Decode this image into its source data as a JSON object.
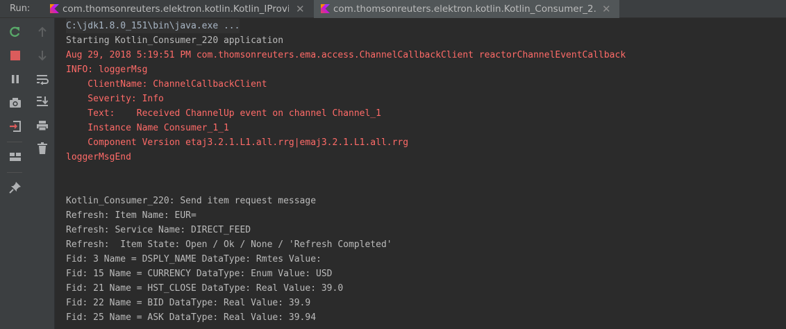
{
  "run_panel": {
    "label": "Run:",
    "tabs": [
      {
        "label": "com.thomsonreuters.elektron.kotlin.Kotlin_IProvi...",
        "active": false,
        "icon": "kotlin-icon"
      },
      {
        "label": "com.thomsonreuters.elektron.kotlin.Kotlin_Consumer_2...",
        "active": true,
        "icon": "kotlin-icon"
      }
    ]
  },
  "toolbar": {
    "left": [
      "rerun-icon",
      "stop-icon",
      "pause-icon",
      "dump-threads-icon",
      "exit-icon",
      "layout-icon",
      "pin-icon"
    ],
    "right": [
      "scroll-up-icon",
      "scroll-down-icon",
      "soft-wrap-icon",
      "scroll-to-end-icon",
      "print-icon",
      "clear-icon"
    ]
  },
  "colors": {
    "stdout": "#bbbbbb",
    "stderr": "#ff6b68",
    "rerun_green": "#59a869",
    "stop_red": "#db5c5c"
  },
  "console": {
    "lines": [
      {
        "text": "C:\\jdk1.8.0_151\\bin\\java.exe ...",
        "kind": "cmd"
      },
      {
        "text": "Starting Kotlin_Consumer_220 application",
        "kind": "out"
      },
      {
        "text": "Aug 29, 2018 5:19:51 PM com.thomsonreuters.ema.access.ChannelCallbackClient reactorChannelEventCallback",
        "kind": "err"
      },
      {
        "text": "INFO: loggerMsg",
        "kind": "err"
      },
      {
        "text": "    ClientName: ChannelCallbackClient",
        "kind": "err"
      },
      {
        "text": "    Severity: Info",
        "kind": "err"
      },
      {
        "text": "    Text:    Received ChannelUp event on channel Channel_1",
        "kind": "err"
      },
      {
        "text": "    Instance Name Consumer_1_1",
        "kind": "err"
      },
      {
        "text": "    Component Version etaj3.2.1.L1.all.rrg|emaj3.2.1.L1.all.rrg",
        "kind": "err"
      },
      {
        "text": "loggerMsgEnd",
        "kind": "err"
      },
      {
        "text": "",
        "kind": "out"
      },
      {
        "text": "",
        "kind": "out"
      },
      {
        "text": "Kotlin_Consumer_220: Send item request message",
        "kind": "out"
      },
      {
        "text": "Refresh: Item Name: EUR=",
        "kind": "out"
      },
      {
        "text": "Refresh: Service Name: DIRECT_FEED",
        "kind": "out"
      },
      {
        "text": "Refresh:  Item State: Open / Ok / None / 'Refresh Completed'",
        "kind": "out"
      },
      {
        "text": "Fid: 3 Name = DSPLY_NAME DataType: Rmtes Value:",
        "kind": "out"
      },
      {
        "text": "Fid: 15 Name = CURRENCY DataType: Enum Value: USD",
        "kind": "out"
      },
      {
        "text": "Fid: 21 Name = HST_CLOSE DataType: Real Value: 39.0",
        "kind": "out"
      },
      {
        "text": "Fid: 22 Name = BID DataType: Real Value: 39.9",
        "kind": "out"
      },
      {
        "text": "Fid: 25 Name = ASK DataType: Real Value: 39.94",
        "kind": "out"
      }
    ]
  }
}
